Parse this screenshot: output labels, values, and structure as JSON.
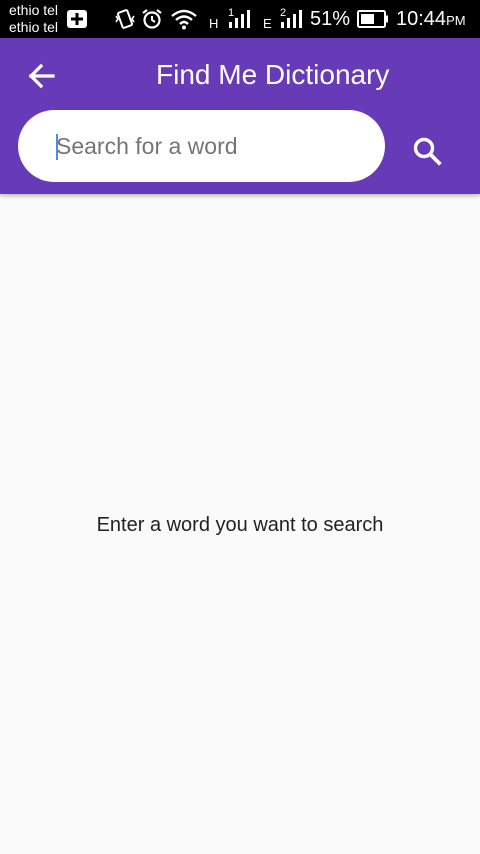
{
  "status_bar": {
    "carriers": [
      "ethio tel",
      "ethio tel"
    ],
    "network_1": "H",
    "sim_1": "1",
    "network_2": "E",
    "sim_2": "2",
    "battery_percent": "51%",
    "time": "10:44",
    "ampm": "PM",
    "icons": [
      "sim-add-icon",
      "vibrate-icon",
      "alarm-icon",
      "wifi-icon",
      "signal-icon",
      "battery-icon"
    ]
  },
  "app_bar": {
    "title": "Find Me Dictionary",
    "back_icon": "arrow-back-icon",
    "search_icon": "search-icon",
    "background_color": "#673ab7"
  },
  "search": {
    "placeholder": "Search for a word",
    "value": ""
  },
  "main": {
    "empty_message": "Enter a word you want to search"
  }
}
